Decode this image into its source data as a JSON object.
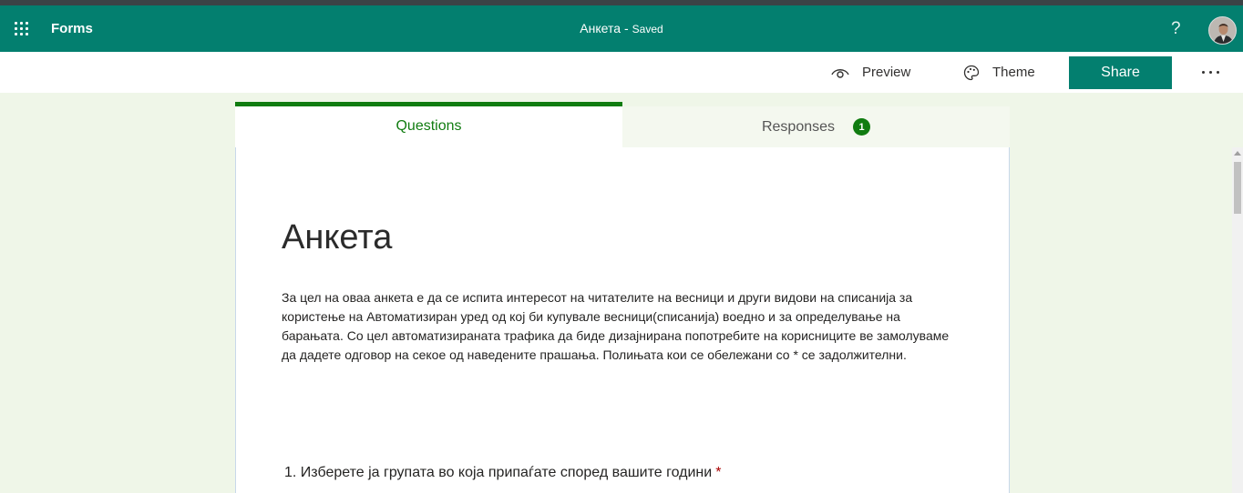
{
  "header": {
    "app_name": "Forms",
    "form_title": "Анкета",
    "separator": "-",
    "save_status": "Saved",
    "help_label": "?",
    "accent_color": "#037f6f"
  },
  "toolbar": {
    "preview_label": "Preview",
    "theme_label": "Theme",
    "share_label": "Share"
  },
  "tabs": {
    "questions_label": "Questions",
    "responses_label": "Responses",
    "responses_count": "1"
  },
  "form": {
    "title": "Анкета",
    "description": "За цел на оваа анкета е да се испита интересот на читателите на весници и други видови на списанија за користење на Автоматизиран уред од кој би купувале весници(списанија) воедно и за определување на барањата. Со цел автоматизираната трафика да биде дизајнирана попотребите на корисниците ве замолуваме да дадете одговор на секое од наведените прашања. Полињата кои се обележани со * се задолжителни.",
    "questions": [
      {
        "number": "1.",
        "text": "Изберете ја групата во која припаѓате според вашите години",
        "required_mark": "*"
      }
    ]
  }
}
